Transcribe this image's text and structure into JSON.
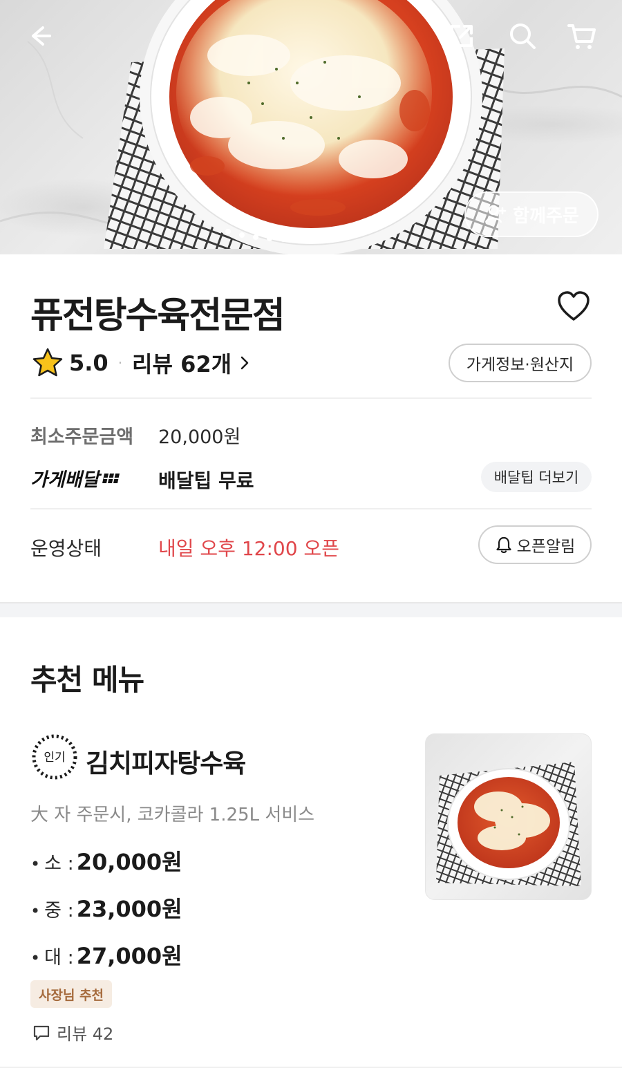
{
  "hero": {
    "together_order_label": "함께주문"
  },
  "store": {
    "name": "퓨전탕수육전문점",
    "rating": "5.0",
    "rating_separator": "·",
    "review_count_label": "리뷰 62개",
    "info_button_label": "가게정보·원산지",
    "min_order_label": "최소주문금액",
    "min_order_value": "20,000원",
    "delivery_type_label": "가게배달",
    "delivery_tip_value": "배달팁 무료",
    "delivery_tip_more_label": "배달팁 더보기",
    "status_label": "운영상태",
    "status_value": "내일 오후 12:00 오픈",
    "open_alarm_label": "오픈알림"
  },
  "recommended": {
    "section_title": "추천 메뉴",
    "item": {
      "badge_text": "인기",
      "name": "김치피자탕수육",
      "description": "大 자 주문시, 코카콜라 1.25L 서비스",
      "prices": [
        {
          "bullet": "•",
          "size": "소 :",
          "amount": "20,000원"
        },
        {
          "bullet": "•",
          "size": "중 :",
          "amount": "23,000원"
        },
        {
          "bullet": "•",
          "size": "대 :",
          "amount": "27,000원"
        }
      ],
      "tag": "사장님 추천",
      "reviews_label": "리뷰 42"
    }
  },
  "colors": {
    "accent_red": "#e0464a",
    "tag_bg": "#f6ece2",
    "tag_text": "#a56a3c",
    "muted_text": "#8a8a8a"
  },
  "icons": [
    "back-arrow-icon",
    "share-icon",
    "search-icon",
    "cart-icon",
    "add-person-icon",
    "heart-icon",
    "star-icon",
    "chevron-right-icon",
    "delivery-motion-icon",
    "bell-icon",
    "popular-badge-icon",
    "comment-icon"
  ]
}
